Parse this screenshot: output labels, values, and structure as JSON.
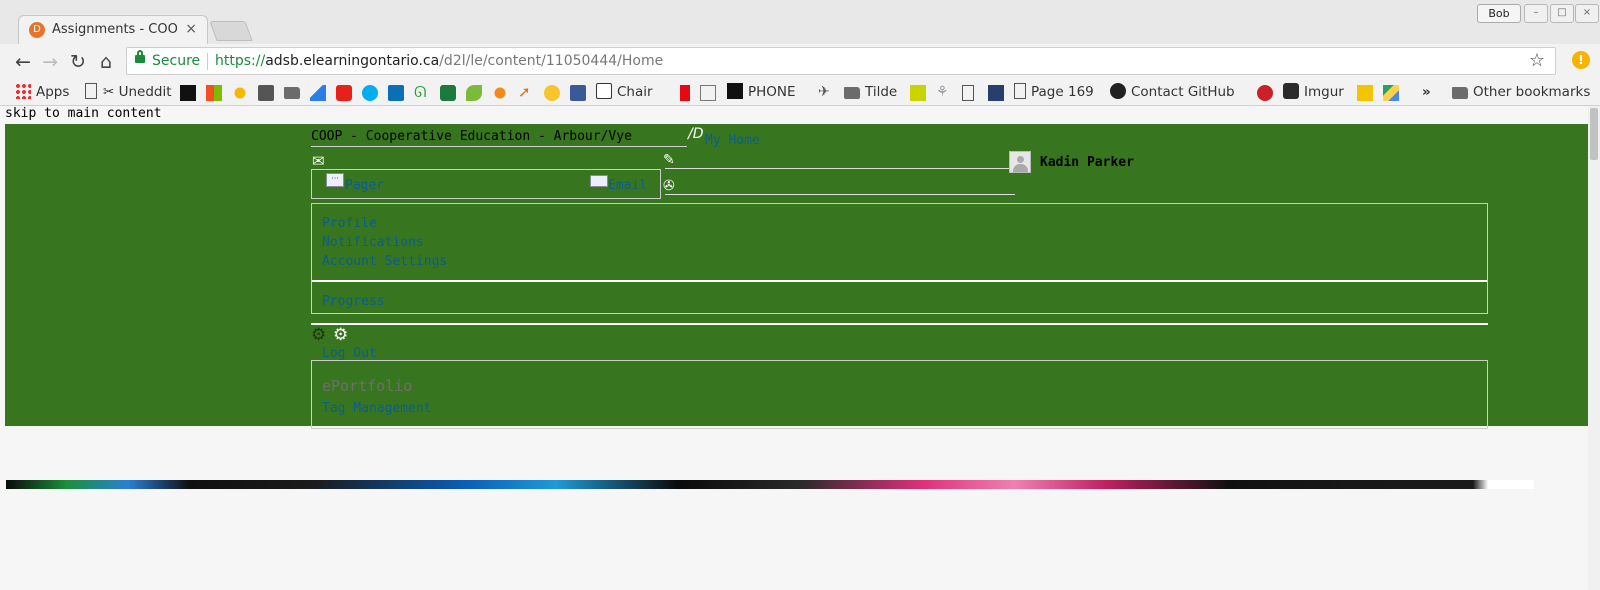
{
  "browser": {
    "tab": {
      "title": "Assignments - COOP -",
      "favicon": "D",
      "close": "×"
    },
    "profile": "Bob",
    "window_controls": {
      "minimize": "–",
      "maximize": "□",
      "close": "×"
    },
    "nav": {
      "back": "←",
      "forward": "→",
      "reload": "↻",
      "home": "⌂"
    },
    "address": {
      "secure_label": "Secure",
      "protocol": "https://",
      "host": "adsb.elearningontario.ca",
      "path": "/d2l/le/content/11050444/Home"
    },
    "star": "☆",
    "extension": "!"
  },
  "bookmarks": [
    {
      "label": "Apps",
      "icon": "apps-grid-icon"
    },
    {
      "label": "Uneddit",
      "icon": "scissors-icon"
    },
    {
      "label": "",
      "icon": "wiki-icon"
    },
    {
      "label": "",
      "icon": "windows-icon"
    },
    {
      "label": "",
      "icon": "sun-icon"
    },
    {
      "label": "",
      "icon": "box-icon"
    },
    {
      "label": "",
      "icon": "folder-icon"
    },
    {
      "label": "",
      "icon": "drive-triangle-icon"
    },
    {
      "label": "",
      "icon": "youtube-icon"
    },
    {
      "label": "",
      "icon": "skype-icon"
    },
    {
      "label": "",
      "icon": "sharepoint-icon"
    },
    {
      "label": "",
      "icon": "leaf-icon"
    },
    {
      "label": "",
      "icon": "green-icon"
    },
    {
      "label": "",
      "icon": "lime-leaf-icon"
    },
    {
      "label": "",
      "icon": "orange-gear-icon"
    },
    {
      "label": "",
      "icon": "orange-arrow-icon"
    },
    {
      "label": "",
      "icon": "smiley-icon"
    },
    {
      "label": "",
      "icon": "facebook-icon"
    },
    {
      "label": "Chair",
      "icon": "amazon-icon"
    },
    {
      "label": "",
      "icon": "netflix-icon"
    },
    {
      "label": "",
      "icon": "cart-icon"
    },
    {
      "label": "PHONE",
      "icon": "phone-icon"
    },
    {
      "label": "",
      "icon": "bird-icon"
    },
    {
      "label": "Tilde",
      "icon": "folder-icon"
    },
    {
      "label": "",
      "icon": "yellow-u-icon"
    },
    {
      "label": "",
      "icon": "feather-icon"
    },
    {
      "label": "",
      "icon": "page-icon"
    },
    {
      "label": "",
      "icon": "chart-icon"
    },
    {
      "label": "Page 169",
      "icon": "page-icon"
    },
    {
      "label": "Contact GitHub",
      "icon": "github-icon"
    },
    {
      "label": "",
      "icon": "pinterest-icon"
    },
    {
      "label": "Imgur",
      "icon": "imgur-icon"
    },
    {
      "label": "",
      "icon": "p-icon"
    },
    {
      "label": "",
      "icon": "gdrive-icon"
    }
  ],
  "bookmarks_overflow": "»",
  "other_bookmarks": "Other bookmarks",
  "page": {
    "skip_link": "skip to main content",
    "org_title": "COOP - Cooperative Education - Arbour/Vye",
    "logo_text": "/D",
    "my_home": "My Home",
    "user_name": "Kadin Parker",
    "pager": "Pager",
    "email": "Email",
    "menu": [
      "Profile",
      "Notifications",
      "Account Settings"
    ],
    "progress": "Progress",
    "log_out": "Log Out",
    "eportfolio": "ePortfolio",
    "tag_management": "Tag Management"
  },
  "colors": {
    "banner": "#37761e",
    "link": "#0b5d8f",
    "secure": "#1b8a3c"
  }
}
